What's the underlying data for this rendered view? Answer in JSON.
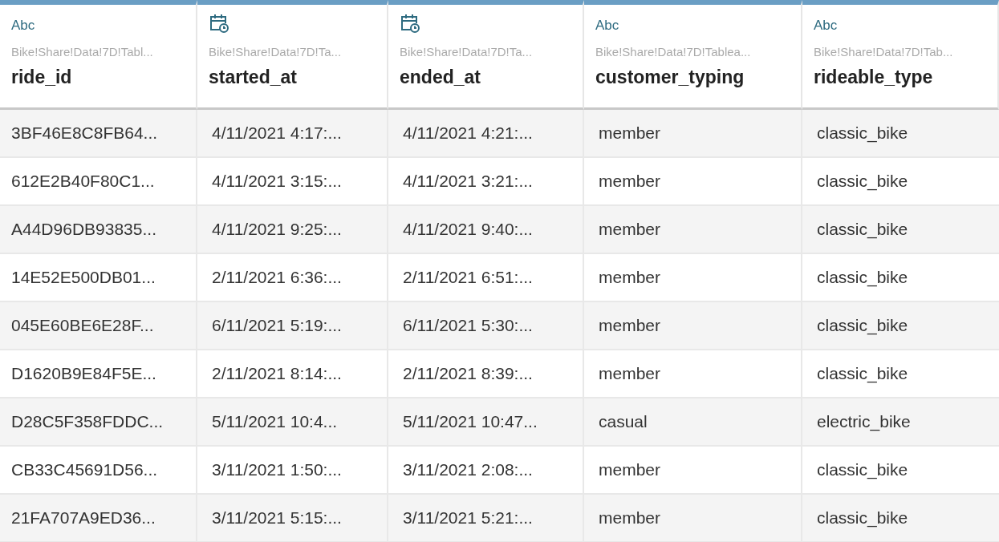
{
  "table": {
    "columns": [
      {
        "kind": "string",
        "type_label": "Abc",
        "source": "Bike!Share!Data!7D!Tabl...",
        "name": "ride_id"
      },
      {
        "kind": "date",
        "source": "Bike!Share!Data!7D!Ta...",
        "name": "started_at"
      },
      {
        "kind": "date",
        "source": "Bike!Share!Data!7D!Ta...",
        "name": "ended_at"
      },
      {
        "kind": "string",
        "type_label": "Abc",
        "source": "Bike!Share!Data!7D!Tablea...",
        "name": "customer_typing"
      },
      {
        "kind": "string",
        "type_label": "Abc",
        "source": "Bike!Share!Data!7D!Tab...",
        "name": "rideable_type"
      }
    ],
    "rows": [
      [
        "3BF46E8C8FB64...",
        "4/11/2021 4:17:...",
        "4/11/2021 4:21:...",
        "member",
        "classic_bike"
      ],
      [
        "612E2B40F80C1...",
        "4/11/2021 3:15:...",
        "4/11/2021 3:21:...",
        "member",
        "classic_bike"
      ],
      [
        "A44D96DB93835...",
        "4/11/2021 9:25:...",
        "4/11/2021 9:40:...",
        "member",
        "classic_bike"
      ],
      [
        "14E52E500DB01...",
        "2/11/2021 6:36:...",
        "2/11/2021 6:51:...",
        "member",
        "classic_bike"
      ],
      [
        "045E60BE6E28F...",
        "6/11/2021 5:19:...",
        "6/11/2021 5:30:...",
        "member",
        "classic_bike"
      ],
      [
        "D1620B9E84F5E...",
        "2/11/2021 8:14:...",
        "2/11/2021 8:39:...",
        "member",
        "classic_bike"
      ],
      [
        "D28C5F358FDDC...",
        "5/11/2021 10:4...",
        "5/11/2021 10:47...",
        "casual",
        "electric_bike"
      ],
      [
        "CB33C45691D56...",
        "3/11/2021 1:50:...",
        "3/11/2021 2:08:...",
        "member",
        "classic_bike"
      ],
      [
        "21FA707A9ED36...",
        "3/11/2021 5:15:...",
        "3/11/2021 5:21:...",
        "member",
        "classic_bike"
      ]
    ]
  }
}
